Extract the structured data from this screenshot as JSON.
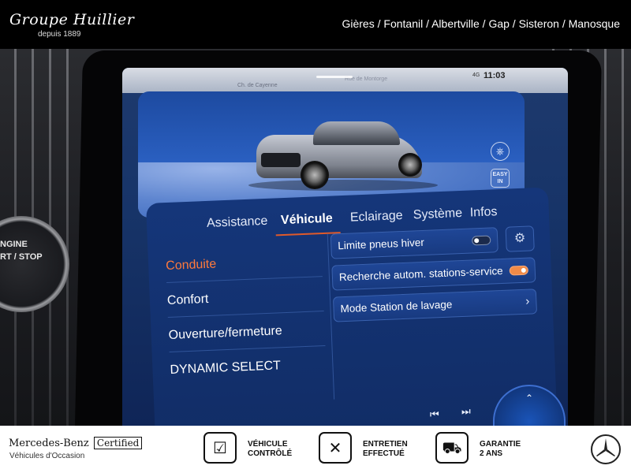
{
  "dealer": {
    "name": "Groupe Huillier",
    "since": "depuis 1889",
    "locations": "Gières / Fontanil / Albertville / Gap / Sisteron / Manosque"
  },
  "console": {
    "start_stop_text": "NGINE\nRT / STOP"
  },
  "screen": {
    "map_labels": [
      "Ch. de Cayenne",
      "Rue de Montorge"
    ],
    "clock": "11:03",
    "status_icon": "4G",
    "hero_icons": [
      "steering-wheel-icon",
      "easy-entry-icon"
    ],
    "easy_label": "EASY\nIN",
    "tabs": [
      {
        "label": "Assistance",
        "active": false
      },
      {
        "label": "Véhicule",
        "active": true
      },
      {
        "label": "Eclairage",
        "active": false
      },
      {
        "label": "Système",
        "active": false
      },
      {
        "label": "Infos",
        "active": false
      }
    ],
    "left_menu": [
      {
        "label": "Conduite",
        "active": true
      },
      {
        "label": "Confort",
        "active": false
      },
      {
        "label": "Ouverture/fermeture",
        "active": false
      },
      {
        "label": "DYNAMIC SELECT",
        "active": false
      }
    ],
    "options": [
      {
        "label": "Limite pneus hiver",
        "control": "toggle",
        "on": false
      },
      {
        "label": "Recherche autom. stations-service",
        "control": "toggle",
        "on": true
      },
      {
        "label": "Mode Station de lavage",
        "control": "chevron"
      }
    ],
    "accent_color": "#e05a2a",
    "toggle_on_color": "#f08a48"
  },
  "footer": {
    "cert_brand": "Mercedes-Benz",
    "cert_label": "Certified",
    "cert_sub": "Véhicules d'Occasion",
    "badges": [
      {
        "icon": "checklist-icon",
        "text": "VÉHICULE\nCONTRÔLÉ"
      },
      {
        "icon": "tools-icon",
        "text": "ENTRETIEN\nEFFECTUÉ"
      },
      {
        "icon": "car-warranty-icon",
        "text": "GARANTIE\n2 ANS"
      }
    ]
  }
}
